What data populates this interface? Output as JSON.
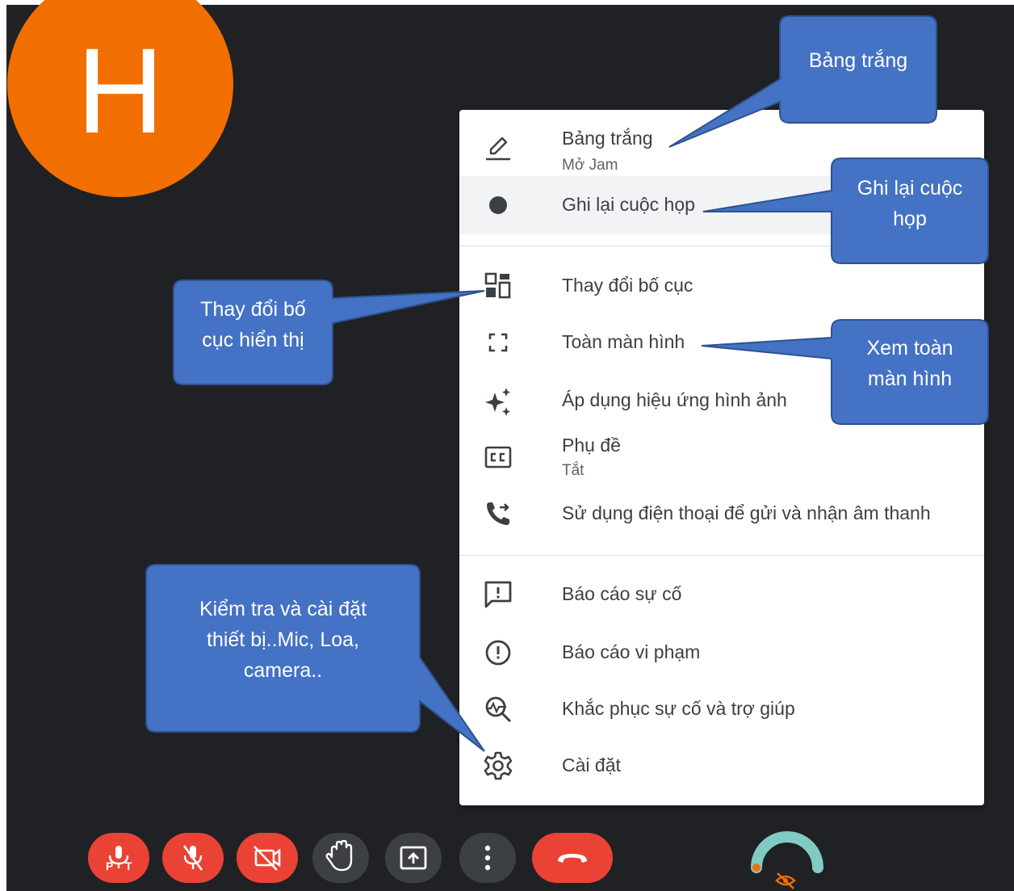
{
  "participant": {
    "initial": "H"
  },
  "menu": {
    "whiteboard": {
      "label": "Bảng trắng",
      "sub": "Mở Jam",
      "icon": "pencil-icon"
    },
    "record": {
      "label": "Ghi lại cuộc họp",
      "icon": "record-dot-icon"
    },
    "layout": {
      "label": "Thay đổi bố cục",
      "icon": "layout-icon"
    },
    "fullscreen": {
      "label": "Toàn màn hình",
      "icon": "fullscreen-icon"
    },
    "effects": {
      "label": "Áp dụng hiệu ứng hình ảnh",
      "icon": "sparkle-icon"
    },
    "captions": {
      "label": "Phụ đề",
      "sub": "Tắt",
      "icon": "closed-caption-icon"
    },
    "phone": {
      "label": "Sử dụng điện thoại để gửi và nhận âm thanh",
      "icon": "phone-forward-icon"
    },
    "report_problem": {
      "label": "Báo cáo sự cố",
      "icon": "feedback-icon"
    },
    "report_abuse": {
      "label": "Báo cáo vi phạm",
      "icon": "report-icon"
    },
    "troubleshoot": {
      "label": "Khắc phục sự cố và trợ giúp",
      "icon": "troubleshoot-icon"
    },
    "settings": {
      "label": "Cài đặt",
      "icon": "gear-icon"
    }
  },
  "callouts": {
    "whiteboard": [
      "Bảng trắng"
    ],
    "record": [
      "Ghi lại cuộc",
      "họp"
    ],
    "layout": [
      "Thay đổi bố",
      "cục hiển thị"
    ],
    "fullscreen": [
      "Xem toàn",
      "màn hình"
    ],
    "settings": [
      "Kiểm tra và cài đặt",
      "thiết bị..Mic, Loa,",
      "camera.."
    ]
  },
  "toolbar": [
    "push-to-talk-icon",
    "mic-off-icon",
    "camera-off-icon",
    "raise-hand-icon",
    "present-screen-icon",
    "more-options-icon",
    "end-call-icon"
  ],
  "colors": {
    "background": "#202124",
    "avatar": "#f16f00",
    "callout": "#4472c4",
    "callout_border": "#2f528f",
    "control_red": "#ea4335",
    "control_gray": "#3c4043"
  }
}
